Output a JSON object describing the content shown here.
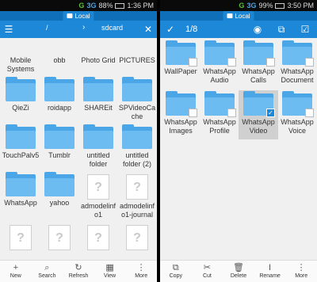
{
  "left": {
    "status": {
      "g": "G",
      "net": "3G",
      "battery": "88%",
      "time": "1:36 PM"
    },
    "tab_label": "Local",
    "toolbar": {
      "crumb_root": "/",
      "crumb_current": "sdcard",
      "menu_icon": "list-icon",
      "close_icon": "close-icon"
    },
    "folders": [
      {
        "label": "Mobile Systems",
        "kind": "folder"
      },
      {
        "label": "obb",
        "kind": "folder"
      },
      {
        "label": "Photo Grid",
        "kind": "folder"
      },
      {
        "label": "PICTURES",
        "kind": "folder"
      },
      {
        "label": "QieZi",
        "kind": "folder"
      },
      {
        "label": "roidapp",
        "kind": "folder"
      },
      {
        "label": "SHAREit",
        "kind": "folder"
      },
      {
        "label": "SPVideoCache",
        "kind": "folder"
      },
      {
        "label": "TouchPalv5",
        "kind": "folder"
      },
      {
        "label": "Tumblr",
        "kind": "folder"
      },
      {
        "label": "untitled folder",
        "kind": "folder"
      },
      {
        "label": "untitled folder (2)",
        "kind": "folder"
      },
      {
        "label": "WhatsApp",
        "kind": "folder"
      },
      {
        "label": "yahoo",
        "kind": "folder"
      },
      {
        "label": "admodelinfo1",
        "kind": "file"
      },
      {
        "label": "admodelinfo1-journal",
        "kind": "file"
      },
      {
        "label": "",
        "kind": "file"
      },
      {
        "label": "",
        "kind": "file"
      },
      {
        "label": "",
        "kind": "file"
      },
      {
        "label": "",
        "kind": "file"
      }
    ],
    "bottom": [
      {
        "label": "New",
        "icon": "plus-icon"
      },
      {
        "label": "Search",
        "icon": "search-icon"
      },
      {
        "label": "Refresh",
        "icon": "refresh-icon"
      },
      {
        "label": "View",
        "icon": "grid-view-icon"
      },
      {
        "label": "More",
        "icon": "more-icon"
      }
    ]
  },
  "right": {
    "status": {
      "g": "G",
      "net": "3G",
      "battery": "99%",
      "time": "3:50 PM"
    },
    "tab_label": "Local",
    "toolbar": {
      "selection_count": "1/8"
    },
    "folders": [
      {
        "label": "WallPaper",
        "selected": false
      },
      {
        "label": "WhatsApp Audio",
        "selected": false
      },
      {
        "label": "WhatsApp Calls",
        "selected": false
      },
      {
        "label": "WhatsApp Document",
        "selected": false
      },
      {
        "label": "WhatsApp Images",
        "selected": false
      },
      {
        "label": "WhatsApp Profile",
        "selected": false
      },
      {
        "label": "WhatsApp Video",
        "selected": true
      },
      {
        "label": "WhatsApp Voice",
        "selected": false
      }
    ],
    "bottom": [
      {
        "label": "Copy",
        "icon": "copy-icon"
      },
      {
        "label": "Cut",
        "icon": "scissors-icon"
      },
      {
        "label": "Delete",
        "icon": "trash-icon"
      },
      {
        "label": "Rename",
        "icon": "rename-icon"
      },
      {
        "label": "More",
        "icon": "more-icon"
      }
    ]
  }
}
